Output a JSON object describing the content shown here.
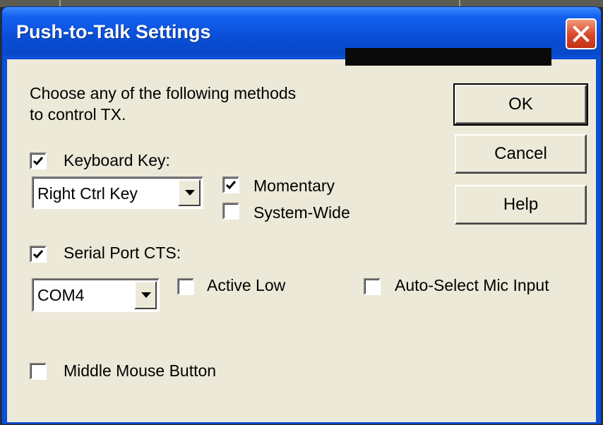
{
  "window": {
    "title": "Push-to-Talk Settings"
  },
  "icons": {
    "close": "close-icon",
    "check": "checkmark-icon",
    "dropdown": "chevron-down-icon"
  },
  "colors": {
    "titlebar": "#0a4fd8",
    "close_button": "#d9462a",
    "client": "#ece9d8"
  },
  "instructions": {
    "line1": "Choose any of the following methods",
    "line2": "to control TX."
  },
  "keyboard": {
    "label": "Keyboard Key:",
    "checked": true,
    "key_select": "Right Ctrl Key",
    "momentary": {
      "label": "Momentary",
      "checked": true
    },
    "system_wide": {
      "label": "System-Wide",
      "checked": false
    }
  },
  "serial": {
    "label": "Serial Port CTS:",
    "checked": true,
    "port_select": "COM4",
    "active_low": {
      "label": "Active Low",
      "checked": false
    },
    "auto_select": {
      "label": "Auto-Select Mic Input",
      "checked": false
    }
  },
  "mouse": {
    "label": "Middle Mouse Button",
    "checked": false
  },
  "buttons": {
    "ok": "OK",
    "cancel": "Cancel",
    "help": "Help"
  }
}
